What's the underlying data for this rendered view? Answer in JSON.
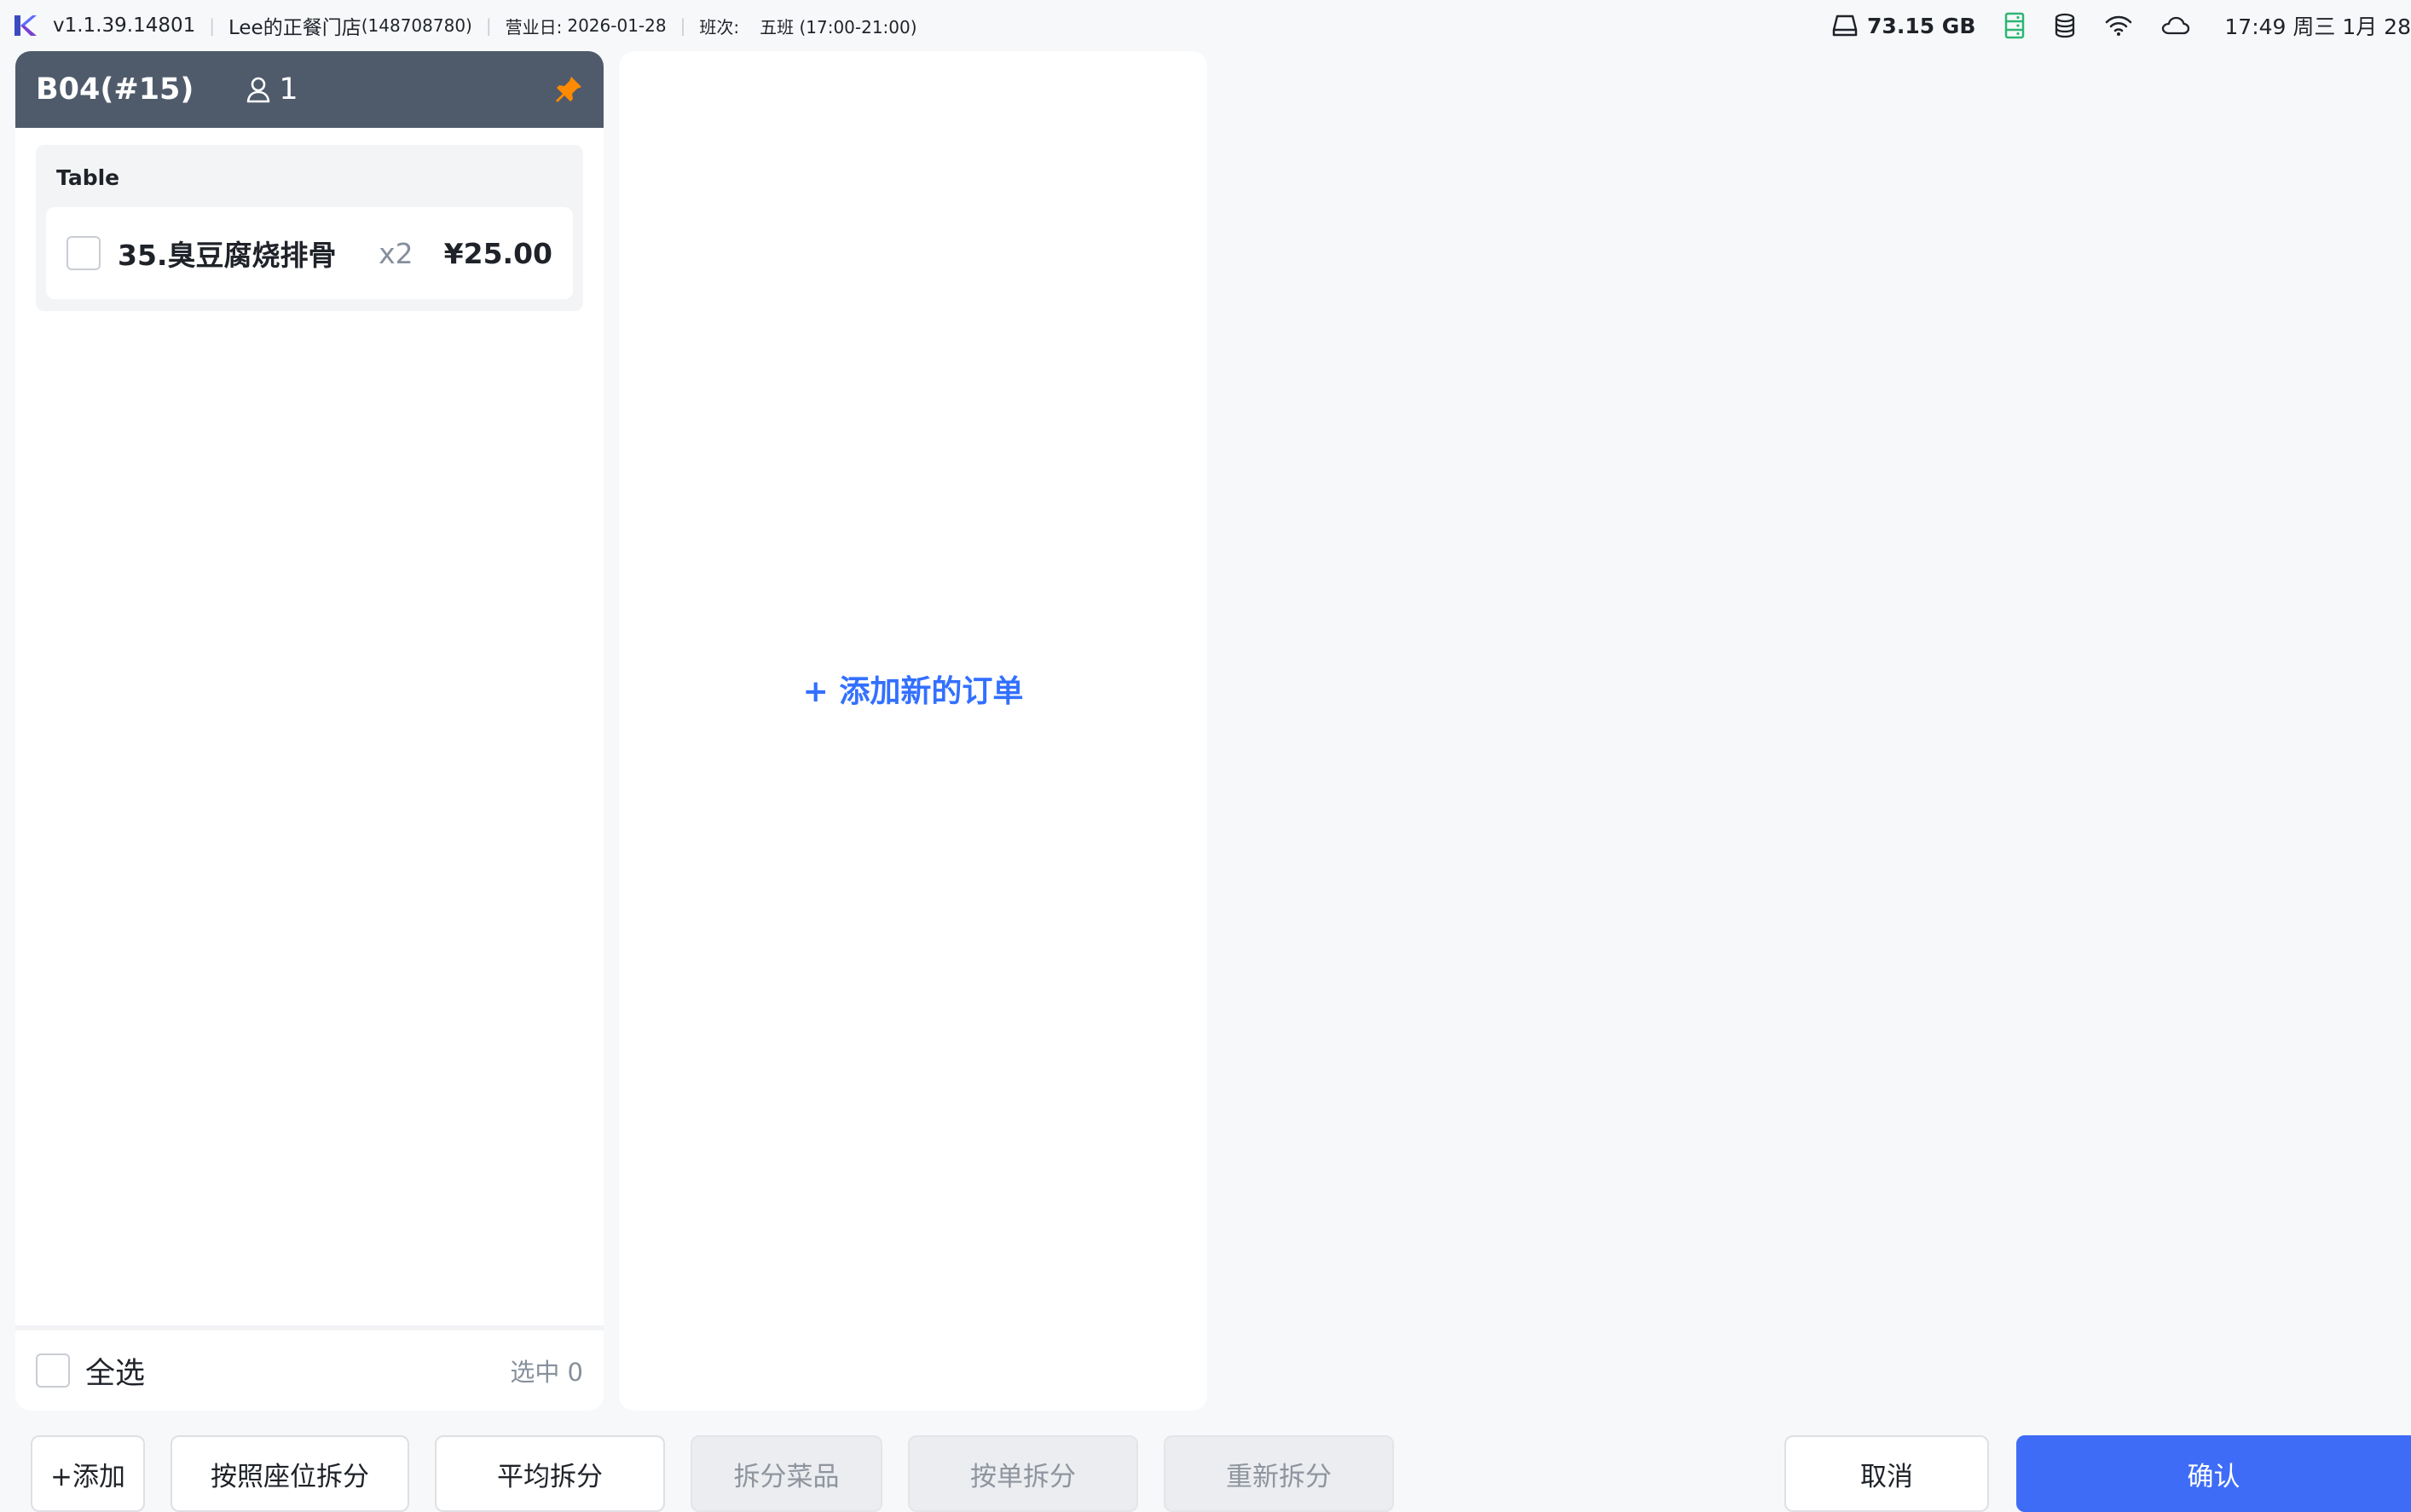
{
  "statusbar": {
    "version": "v1.1.39.14801",
    "store_name": "Lee的正餐门店",
    "store_id": "(148708780)",
    "business_day_label": "营业日:",
    "business_day": "2026-01-28",
    "shift_label": "班次:",
    "shift": "五班 (17:00-21:00)",
    "disk_free": "73.15 GB",
    "clock": "17:49 周三 1月 28",
    "icons": [
      "app-logo-icon",
      "disk-icon",
      "server-status-icon",
      "database-icon",
      "wifi-icon",
      "cloud-icon"
    ],
    "server_icon_color": "#2bb673"
  },
  "order": {
    "title": "B04(#15)",
    "guests": "1",
    "pin_color": "#ff8a00",
    "header_color": "#4f5b6b",
    "group_title": "Table",
    "items": [
      {
        "name": "35.臭豆腐烧排骨",
        "qty": "x2",
        "price": "¥25.00"
      }
    ],
    "select_all_label": "全选",
    "selected_count": "选中 0"
  },
  "new_order": {
    "label": "+ 添加新的订单",
    "color": "#3370ff"
  },
  "actions": {
    "add": "+添加",
    "split_by_seat": "按照座位拆分",
    "split_evenly": "平均拆分",
    "split_dishes": "拆分菜品",
    "split_by_order": "按单拆分",
    "resplit": "重新拆分",
    "cancel": "取消",
    "confirm": "确认",
    "confirm_color": "#3f6cf6"
  }
}
